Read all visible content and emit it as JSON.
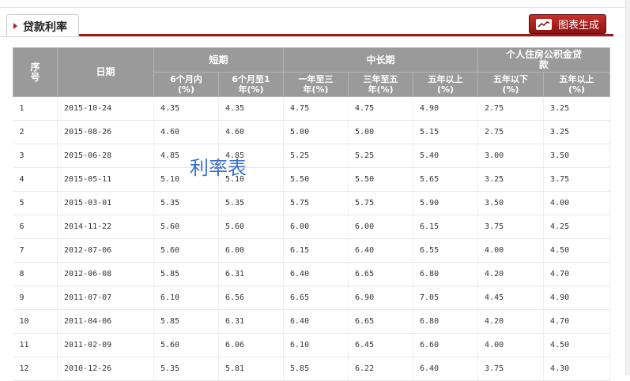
{
  "tab": {
    "label": "贷款利率"
  },
  "button": {
    "label": "图表生成",
    "icon": "line-chart-icon"
  },
  "watermark": "利率表",
  "headers": {
    "seq": "序号",
    "date": "日期",
    "short": "短期",
    "short_6m": "6个月内(%)",
    "short_6m_1y": "6个月至1年(%)",
    "mid_long": "中长期",
    "ml_1_3": "一年至三年(%)",
    "ml_3_5": "三年至五年(%)",
    "ml_5plus": "五年以上(%)",
    "fund": "个人住房公积金贷款",
    "fund_5minus": "五年以下(%)",
    "fund_5plus": "五年以上(%)"
  },
  "rows": [
    [
      "1",
      "2015-10-24",
      "4.35",
      "4.35",
      "4.75",
      "4.75",
      "4.90",
      "2.75",
      "3.25"
    ],
    [
      "2",
      "2015-08-26",
      "4.60",
      "4.60",
      "5.00",
      "5.00",
      "5.15",
      "2.75",
      "3.25"
    ],
    [
      "3",
      "2015-06-28",
      "4.85",
      "4.85",
      "5.25",
      "5.25",
      "5.40",
      "3.00",
      "3.50"
    ],
    [
      "4",
      "2015-05-11",
      "5.10",
      "5.10",
      "5.50",
      "5.50",
      "5.65",
      "3.25",
      "3.75"
    ],
    [
      "5",
      "2015-03-01",
      "5.35",
      "5.35",
      "5.75",
      "5.75",
      "5.90",
      "3.50",
      "4.00"
    ],
    [
      "6",
      "2014-11-22",
      "5.60",
      "5.60",
      "6.00",
      "6.00",
      "6.15",
      "3.75",
      "4.25"
    ],
    [
      "7",
      "2012-07-06",
      "5.60",
      "6.00",
      "6.15",
      "6.40",
      "6.55",
      "4.00",
      "4.50"
    ],
    [
      "8",
      "2012-06-08",
      "5.85",
      "6.31",
      "6.40",
      "6.65",
      "6.80",
      "4.20",
      "4.70"
    ],
    [
      "9",
      "2011-07-07",
      "6.10",
      "6.56",
      "6.65",
      "6.90",
      "7.05",
      "4.45",
      "4.90"
    ],
    [
      "10",
      "2011-04-06",
      "5.85",
      "6.31",
      "6.40",
      "6.65",
      "6.80",
      "4.20",
      "4.70"
    ],
    [
      "11",
      "2011-02-09",
      "5.60",
      "6.06",
      "6.10",
      "6.45",
      "6.60",
      "4.00",
      "4.50"
    ],
    [
      "12",
      "2010-12-26",
      "5.35",
      "5.81",
      "5.85",
      "6.22",
      "6.40",
      "3.75",
      "4.30"
    ]
  ],
  "colors": {
    "accent": "#9c1a1a",
    "header_bg": "#9a9a9a",
    "watermark": "#3a6fc8"
  }
}
